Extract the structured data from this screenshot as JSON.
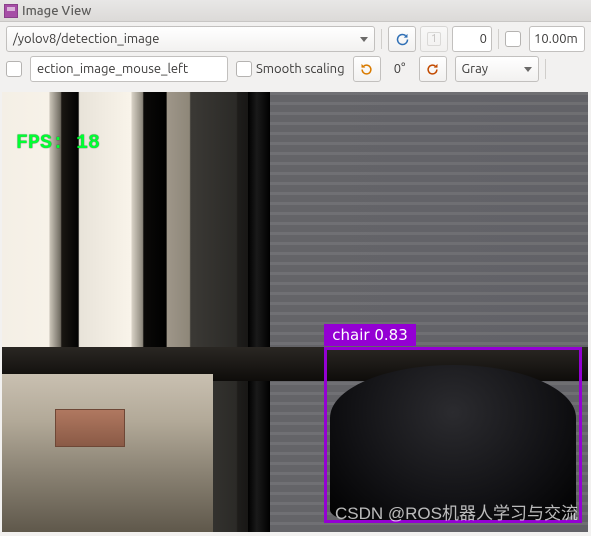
{
  "window": {
    "title": "Image View"
  },
  "toolbar": {
    "topic": "/yolov8/detection_image",
    "refresh_icon": "refresh-icon",
    "pin_label": "1",
    "frame_num": "0",
    "rate": "10.00m",
    "mouse_topic": "ection_image_mouse_left",
    "smooth_label": "Smooth scaling",
    "rotate_deg": "0°",
    "colormap": "Gray"
  },
  "overlay": {
    "fps_label": "FPS: 18",
    "detection": {
      "label": "chair 0.83"
    },
    "watermark": "CSDN @ROS机器人学习与交流"
  }
}
